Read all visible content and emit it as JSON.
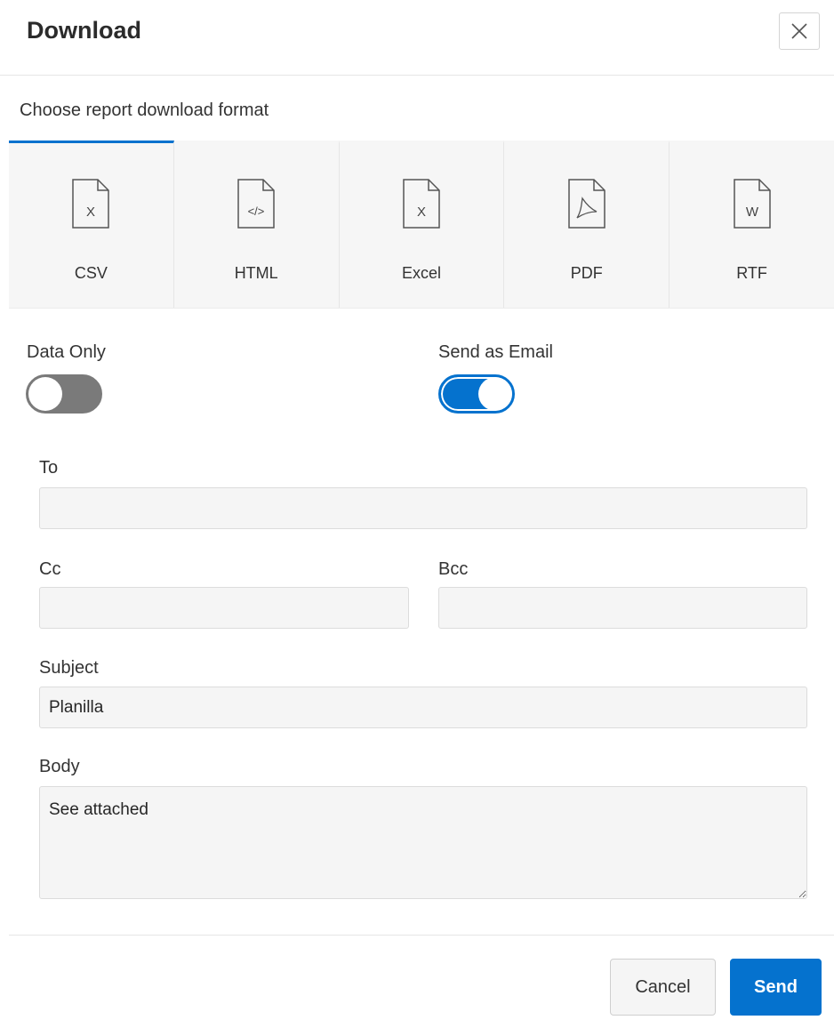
{
  "dialog": {
    "title": "Download",
    "close_icon": "close-icon",
    "subtitle": "Choose report download format"
  },
  "formats": [
    {
      "label": "CSV",
      "icon": "csv-file-icon",
      "glyph": "X",
      "selected": true
    },
    {
      "label": "HTML",
      "icon": "html-file-icon",
      "glyph": "</>",
      "selected": false
    },
    {
      "label": "Excel",
      "icon": "excel-file-icon",
      "glyph": "X",
      "selected": false
    },
    {
      "label": "PDF",
      "icon": "pdf-file-icon",
      "glyph": "",
      "selected": false
    },
    {
      "label": "RTF",
      "icon": "rtf-file-icon",
      "glyph": "W",
      "selected": false
    }
  ],
  "options": {
    "data_only": {
      "label": "Data Only",
      "checked": false
    },
    "send_as_email": {
      "label": "Send as Email",
      "checked": true
    }
  },
  "email": {
    "to": {
      "label": "To",
      "value": ""
    },
    "cc": {
      "label": "Cc",
      "value": ""
    },
    "bcc": {
      "label": "Bcc",
      "value": ""
    },
    "subject": {
      "label": "Subject",
      "value": "Planilla"
    },
    "body": {
      "label": "Body",
      "value": "See attached"
    }
  },
  "buttons": {
    "cancel": "Cancel",
    "send": "Send"
  },
  "colors": {
    "accent": "#0572ce",
    "toggle_off": "#7a7a7a"
  }
}
